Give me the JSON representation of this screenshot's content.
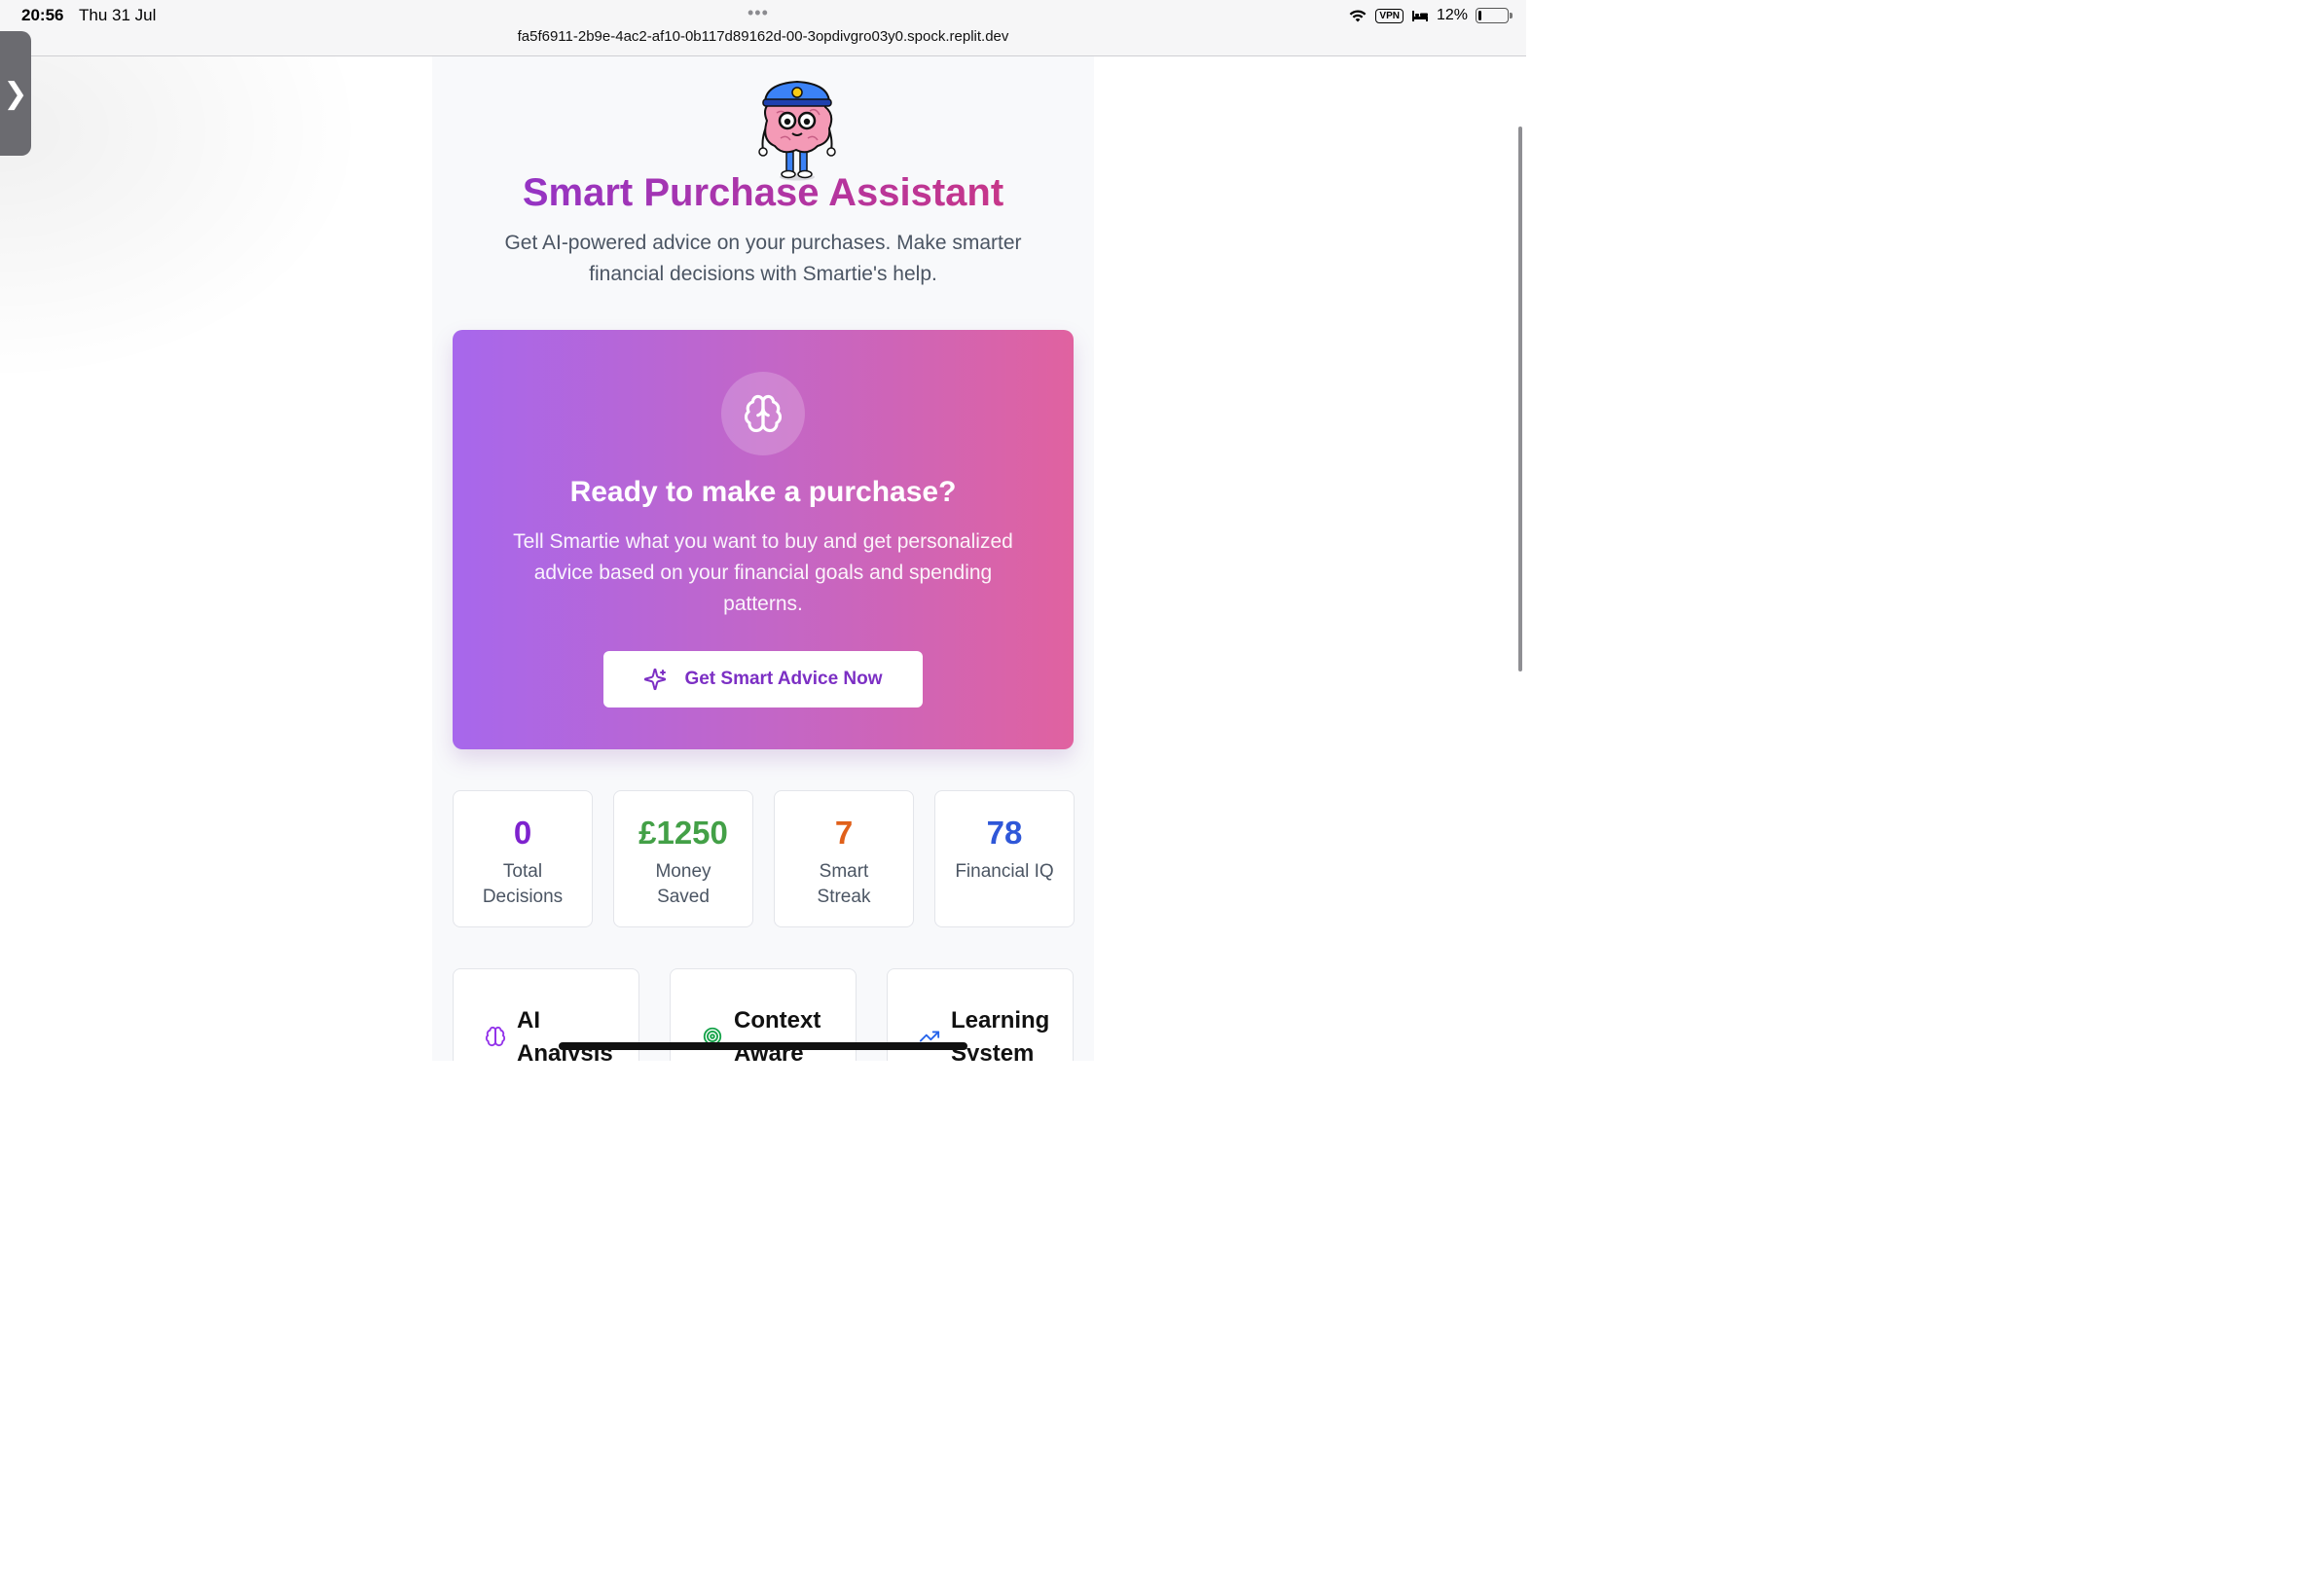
{
  "statusbar": {
    "time": "20:56",
    "date": "Thu 31 Jul",
    "dots": "•••",
    "url": "fa5f6911-2b9e-4ac2-af10-0b117d89162d-00-3opdivgro03y0.spock.replit.dev",
    "vpn": "VPN",
    "battery": "12%",
    "battery_level": 0.12
  },
  "side_tab": {
    "chevron": "❯"
  },
  "page": {
    "title": "Smart Purchase Assistant",
    "subtitle": "Get AI-powered advice on your purchases. Make smarter financial decisions with Smartie's help."
  },
  "hero": {
    "icon": "brain-icon",
    "title": "Ready to make a purchase?",
    "text": "Tell Smartie what you want to buy and get personalized advice based on your financial goals and spending patterns.",
    "button_icon": "sparkles-icon",
    "button_label": "Get Smart Advice Now"
  },
  "stats": [
    {
      "value": "0",
      "label": "Total Decisions",
      "color": "#7e22ce"
    },
    {
      "value": "£1250",
      "label": "Money Saved",
      "color": "#43a047"
    },
    {
      "value": "7",
      "label": "Smart Streak",
      "color": "#e0601a"
    },
    {
      "value": "78",
      "label": "Financial IQ",
      "color": "#2f57d8"
    }
  ],
  "features": [
    {
      "title": "AI Analysis",
      "icon": "brain-icon",
      "color": "#9333ea"
    },
    {
      "title": "Context Aware",
      "icon": "target-icon",
      "color": "#16a34a"
    },
    {
      "title": "Learning System",
      "icon": "trending-up-icon",
      "color": "#2563eb"
    }
  ],
  "colors": {
    "accent": "#7c2fc4",
    "hero_gradient_start": "#a767ec",
    "hero_gradient_end": "#e062a0"
  }
}
